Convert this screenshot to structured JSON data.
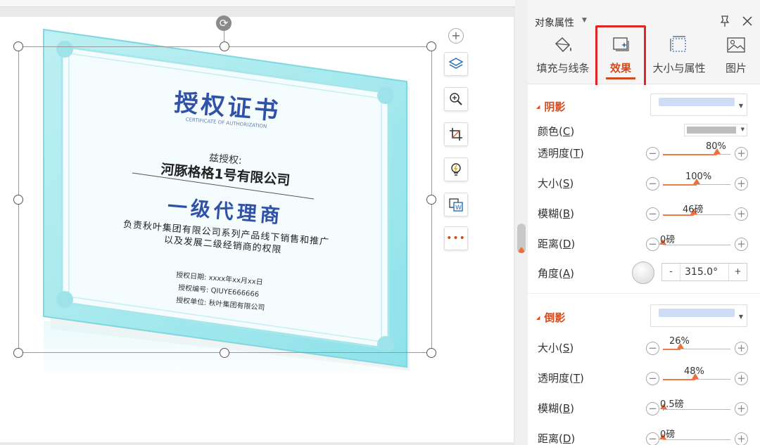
{
  "panel": {
    "title": "对象属性",
    "tabs": [
      {
        "label": "填充与线条",
        "icon": "fill-bucket-icon"
      },
      {
        "label": "效果",
        "icon": "effects-icon"
      },
      {
        "label": "大小与属性",
        "icon": "size-icon"
      },
      {
        "label": "图片",
        "icon": "picture-icon"
      }
    ],
    "active_tab": "效果",
    "shadow": {
      "title": "阴影",
      "color_label": "颜色(C)",
      "color_key": "C",
      "color_value": "#bdbdbd",
      "rows": [
        {
          "label": "透明度(T)",
          "prefix": "透明度(",
          "key": "T",
          "value": "80%",
          "pct": 0.8
        },
        {
          "label": "大小(S)",
          "prefix": "大小(",
          "key": "S",
          "value": "100%",
          "pct": 0.5
        },
        {
          "label": "模糊(B)",
          "prefix": "模糊(",
          "key": "B",
          "value": "46磅",
          "pct": 0.46
        },
        {
          "label": "距离(D)",
          "prefix": "距离(",
          "key": "D",
          "value": "0磅",
          "pct": 0.0
        }
      ],
      "angle": {
        "prefix": "角度(",
        "key": "A",
        "value": "315.0°",
        "minus": "-",
        "plus": "+"
      }
    },
    "reflection": {
      "title": "倒影",
      "rows": [
        {
          "prefix": "大小(",
          "key": "S",
          "value": "26%",
          "pct": 0.26
        },
        {
          "prefix": "透明度(",
          "key": "T",
          "value": "48%",
          "pct": 0.48
        },
        {
          "prefix": "模糊(",
          "key": "B",
          "value": "0.5磅",
          "pct": 0.01
        },
        {
          "prefix": "距离(",
          "key": "D",
          "value": "0磅",
          "pct": 0.0
        }
      ]
    },
    "preset_color": "#cfdcf6",
    "accent": "#d24b1e"
  },
  "certificate": {
    "title": "授权证书",
    "subtitle": "CERTIFICATE OF AUTHORIZATION",
    "grant": "兹授权:",
    "company": "河豚格格1号有限公司",
    "level": "一级代理商",
    "desc1": "负责秋叶集团有限公司系列产品线下销售和推广",
    "desc2": "以及发展二级经销商的权限",
    "date": "授权日期: xxxx年xx月xx日",
    "number": "授权编号: QIUYE666666",
    "unit": "授权单位: 秋叶集团有限公司"
  },
  "float_toolbar": [
    "add-icon",
    "layers-icon",
    "zoom-icon",
    "crop-icon",
    "idea-icon",
    "convert-icon",
    "more-icon"
  ]
}
